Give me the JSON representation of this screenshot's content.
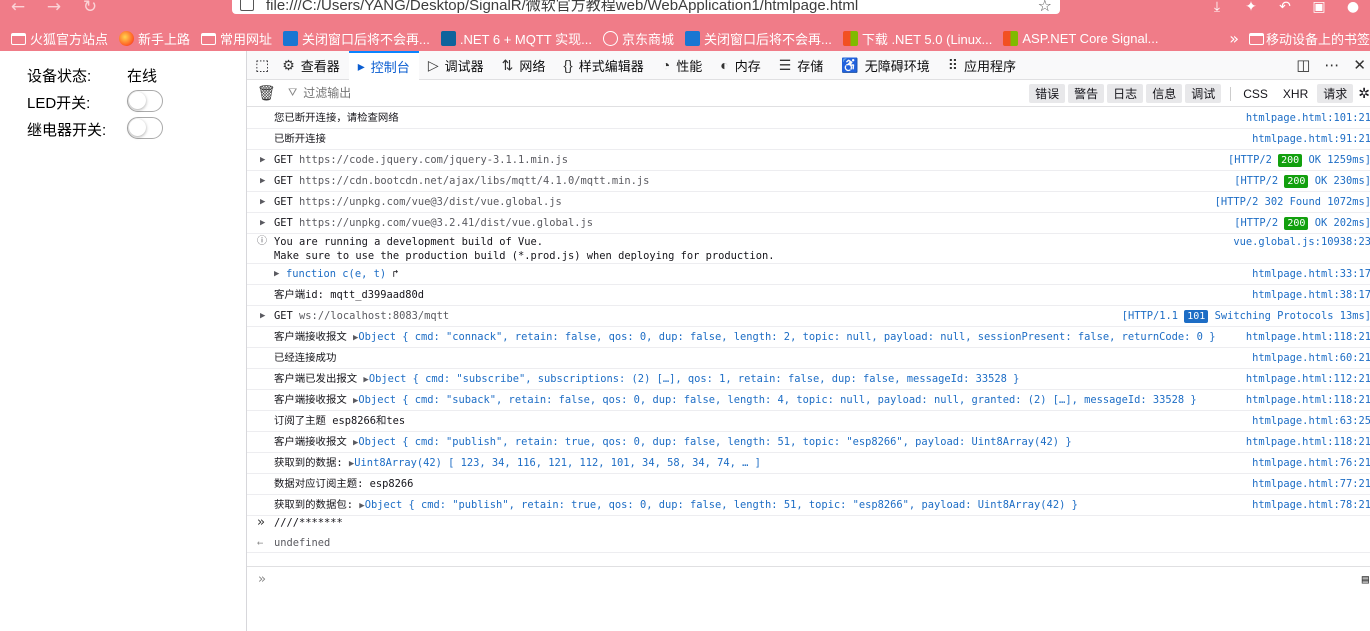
{
  "browser": {
    "url": "file:///C:/Users/YANG/Desktop/SignalR/微软官方教程web/WebApplication1/htmlpage.html",
    "bookmarks": [
      {
        "label": "火狐官方站点",
        "icon": "folder-icon"
      },
      {
        "label": "新手上路",
        "icon": "firefox-icon"
      },
      {
        "label": "常用网址",
        "icon": "folder-icon"
      },
      {
        "label": "关闭窗口后将不会再...",
        "icon": "blue-app-icon"
      },
      {
        "label": ".NET 6 + MQTT 实现...",
        "icon": "vscode-icon"
      },
      {
        "label": "京东商城",
        "icon": "globe-icon"
      },
      {
        "label": "关闭窗口后将不会再...",
        "icon": "blue-app-icon"
      },
      {
        "label": "下载 .NET 5.0 (Linux...",
        "icon": "windows-icon"
      },
      {
        "label": "ASP.NET Core Signal...",
        "icon": "windows-icon"
      }
    ],
    "more_bookmarks": "»",
    "mobile_bookmarks": "移动设备上的书签"
  },
  "page": {
    "status_label": "设备状态:",
    "status_value": "在线",
    "led_label": "LED开关:",
    "relay_label": "继电器开关:"
  },
  "devtools": {
    "tabs": [
      {
        "label": "查看器",
        "icon": "inspector-icon"
      },
      {
        "label": "控制台",
        "icon": "console-icon",
        "active": true
      },
      {
        "label": "调试器",
        "icon": "debugger-icon"
      },
      {
        "label": "网络",
        "icon": "network-icon"
      },
      {
        "label": "样式编辑器",
        "icon": "style-editor-icon"
      },
      {
        "label": "性能",
        "icon": "performance-icon"
      },
      {
        "label": "内存",
        "icon": "memory-icon"
      },
      {
        "label": "存储",
        "icon": "storage-icon"
      },
      {
        "label": "无障碍环境",
        "icon": "accessibility-icon"
      },
      {
        "label": "应用程序",
        "icon": "application-icon"
      }
    ],
    "filter_placeholder": "过滤输出",
    "filter_buttons": [
      "错误",
      "警告",
      "日志",
      "信息",
      "调试"
    ],
    "filter_buttons2": [
      "CSS",
      "XHR",
      "请求"
    ],
    "log": [
      {
        "text": "您已断开连接，请检查网络",
        "loc": "htmlpage.html:101:21"
      },
      {
        "text": "已断开连接",
        "loc": "htmlpage.html:91:21"
      },
      {
        "method": "GET",
        "url": "https://code.jquery.com/jquery-3.1.1.min.js",
        "proto": "[HTTP/2",
        "code": "200",
        "status": "OK 1259ms]"
      },
      {
        "method": "GET",
        "url": "https://cdn.bootcdn.net/ajax/libs/mqtt/4.1.0/mqtt.min.js",
        "proto": "[HTTP/2",
        "code": "200",
        "status": "OK 230ms]"
      },
      {
        "method": "GET",
        "url": "https://unpkg.com/vue@3/dist/vue.global.js",
        "proto": "[HTTP/2",
        "code": "302",
        "status": "Found 1072ms]"
      },
      {
        "method": "GET",
        "url": "https://unpkg.com/vue@3.2.41/dist/vue.global.js",
        "proto": "[HTTP/2",
        "code": "200",
        "status": "OK 202ms]"
      },
      {
        "line1": "You are running a development build of Vue.",
        "line2": "Make sure to use the production build (*.prod.js) when deploying for production.",
        "loc": "vue.global.js:10938:23"
      },
      {
        "text": "function c(e, t)",
        "loc": "htmlpage.html:33:17"
      },
      {
        "text": "客户端id: mqtt_d399aad80d",
        "loc": "htmlpage.html:38:17"
      },
      {
        "method": "GET",
        "url": "ws://localhost:8083/mqtt",
        "proto": "[HTTP/1.1",
        "code": "101",
        "status": "Switching Protocols 13ms]"
      },
      {
        "prefix": "客户端接收报文",
        "text": "Object { cmd: \"connack\", retain: false, qos: 0, dup: false, length: 2, topic: null, payload: null, sessionPresent: false, returnCode: 0 }",
        "loc": "htmlpage.html:118:21"
      },
      {
        "text": "已经连接成功",
        "loc": "htmlpage.html:60:21"
      },
      {
        "prefix": "客户端已发出报文",
        "text": "Object { cmd: \"subscribe\", subscriptions: (2) […], qos: 1, retain: false, dup: false, messageId: 33528 }",
        "loc": "htmlpage.html:112:21"
      },
      {
        "prefix": "客户端接收报文",
        "text": "Object { cmd: \"suback\", retain: false, qos: 0, dup: false, length: 4, topic: null, payload: null, granted: (2) […], messageId: 33528 }",
        "loc": "htmlpage.html:118:21"
      },
      {
        "text": "订阅了主题 esp8266和tes",
        "loc": "htmlpage.html:63:25"
      },
      {
        "prefix": "客户端接收报文",
        "text": "Object { cmd: \"publish\", retain: true, qos: 0, dup: false, length: 51, topic: \"esp8266\", payload: Uint8Array(42) }",
        "loc": "htmlpage.html:118:21"
      },
      {
        "prefix": "获取到的数据:",
        "text": "Uint8Array(42) [ 123, 34, 116, 121, 112, 101, 34, 58, 34, 74, … ]",
        "loc": "htmlpage.html:76:21"
      },
      {
        "text": "数据对应订阅主题:  esp8266",
        "loc": "htmlpage.html:77:21"
      },
      {
        "prefix": "获取到的数据包:",
        "text": "Object { cmd: \"publish\", retain: true, qos: 0, dup: false, length: 51, topic: \"esp8266\", payload: Uint8Array(42) }",
        "loc": "htmlpage.html:78:21"
      }
    ],
    "input_echo": "////*******",
    "result": "undefined",
    "prompt": "»"
  }
}
